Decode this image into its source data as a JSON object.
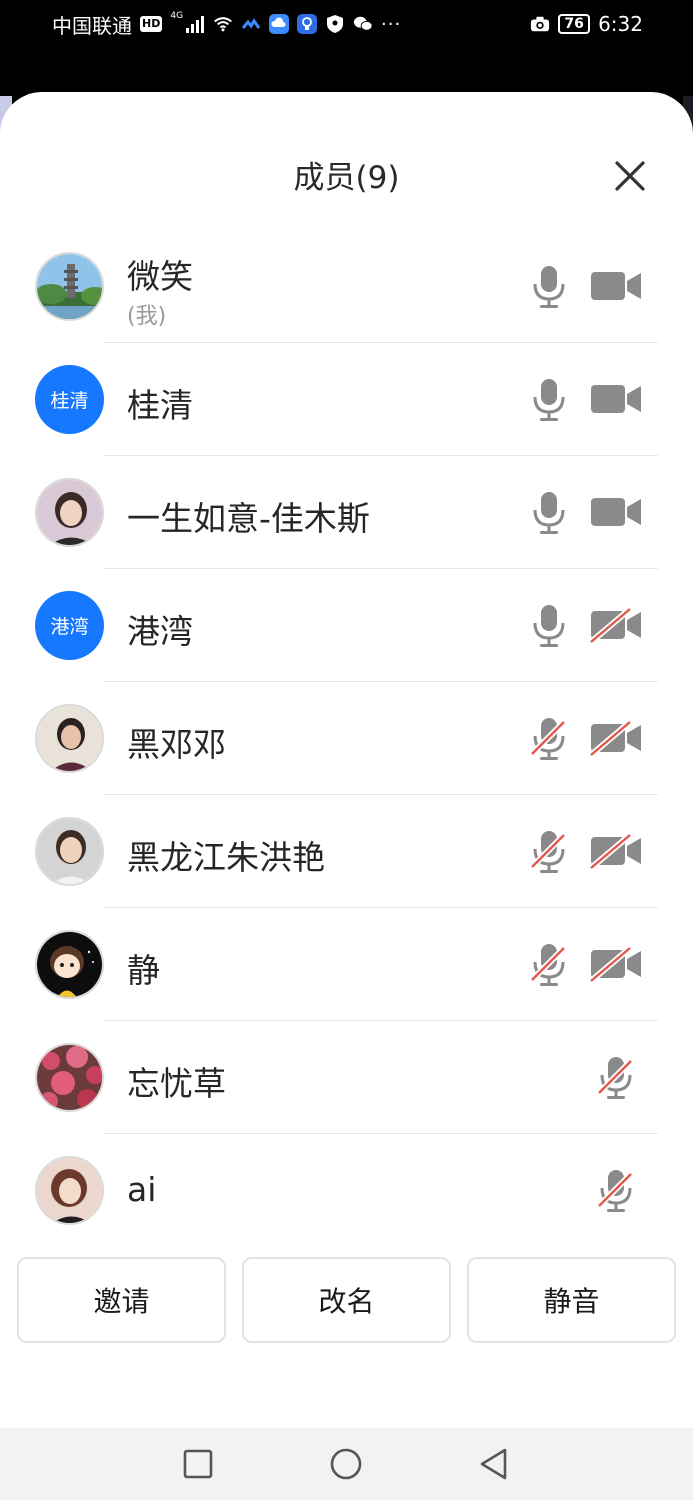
{
  "status_bar": {
    "carrier": "中国联通",
    "hd": "HD",
    "network": "4G",
    "battery": "76",
    "time": "6:32",
    "more": "···",
    "icons": [
      "hd-icon",
      "signal-icon",
      "wifi-icon",
      "cloud-sync-icon",
      "cloud-icon",
      "bulb-icon",
      "shield-icon",
      "wechat-icon",
      "camera-icon",
      "battery-icon"
    ]
  },
  "sheet": {
    "title": "成员(9)",
    "close_icon": "close-icon"
  },
  "members": [
    {
      "name": "微笑",
      "sub": "(我)",
      "avatar": "photo-pagoda",
      "mic_muted": false,
      "cam": "on"
    },
    {
      "name": "桂清",
      "avatar_text": "桂清",
      "avatar": "blue",
      "mic_muted": false,
      "cam": "on"
    },
    {
      "name": "一生如意-佳木斯",
      "avatar": "photo-woman",
      "mic_muted": false,
      "cam": "on"
    },
    {
      "name": "港湾",
      "avatar_text": "港湾",
      "avatar": "blue",
      "mic_muted": false,
      "cam": "off"
    },
    {
      "name": "黑邓邓",
      "avatar": "photo-woman",
      "mic_muted": true,
      "cam": "off"
    },
    {
      "name": "黑龙江朱洪艳",
      "avatar": "photo-woman",
      "mic_muted": true,
      "cam": "off"
    },
    {
      "name": "静",
      "avatar": "cartoon-girl",
      "mic_muted": true,
      "cam": "off"
    },
    {
      "name": "忘忧草",
      "avatar": "photo-blossom",
      "mic_muted": true,
      "cam": "none"
    },
    {
      "name": "ai",
      "avatar": "photo-woman",
      "mic_muted": true,
      "cam": "none"
    }
  ],
  "actions": {
    "invite": "邀请",
    "rename": "改名",
    "mute": "静音"
  },
  "nav": {
    "icons": [
      "recents-icon",
      "home-icon",
      "back-icon"
    ]
  },
  "colors": {
    "accent": "#1677ff",
    "icon_gray": "#8a8a8a",
    "muted_red": "#e2574c"
  }
}
